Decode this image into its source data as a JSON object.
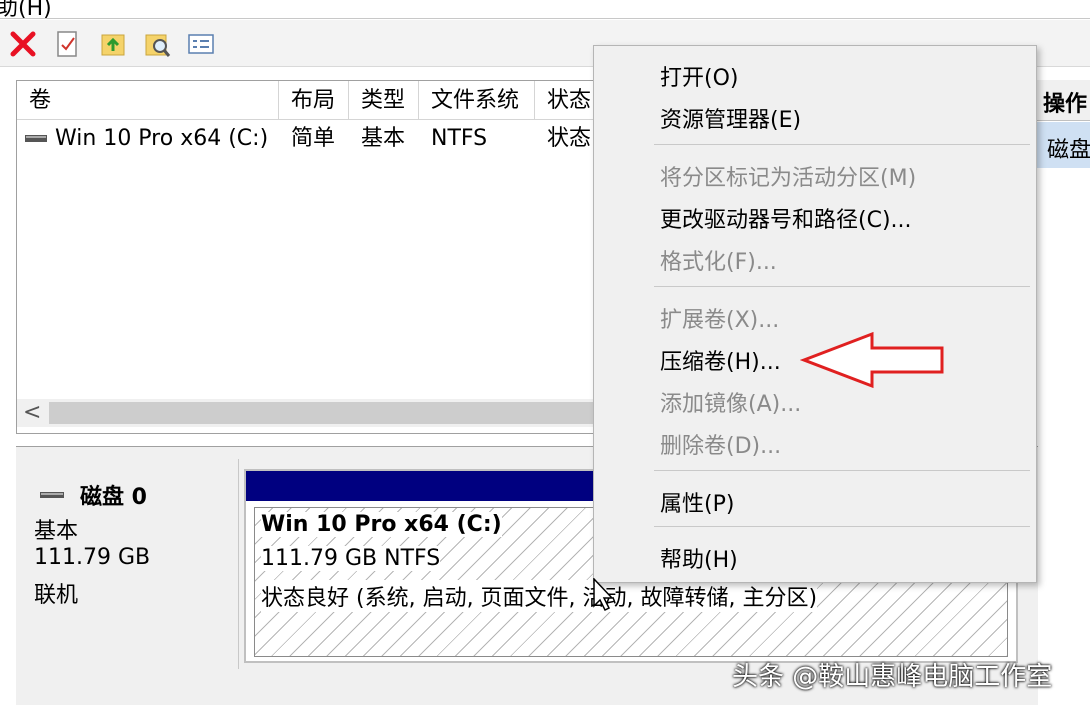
{
  "menubar": {
    "partial": "助(H)"
  },
  "volume_table": {
    "columns": [
      "卷",
      "布局",
      "类型",
      "文件系统",
      "状态"
    ],
    "rows": [
      {
        "volume": "Win 10 Pro x64 (C:)",
        "layout": "简单",
        "type": "基本",
        "fs": "NTFS",
        "status": "状态"
      }
    ],
    "scroll_arrow": "<"
  },
  "actions": {
    "title": "操作",
    "item": "磁盘"
  },
  "disk": {
    "name": "磁盘 0",
    "kind": "基本",
    "size": "111.79 GB",
    "state": "联机",
    "partition": {
      "title": "Win 10 Pro x64  (C:)",
      "size_fs": "111.79 GB NTFS",
      "status": "状态良好 (系统, 启动, 页面文件, 活动, 故障转储, 主分区)"
    }
  },
  "context_menu": {
    "items": [
      {
        "label": "打开(O)",
        "enabled": true
      },
      {
        "label": "资源管理器(E)",
        "enabled": true
      },
      {
        "label": "将分区标记为活动分区(M)",
        "enabled": false
      },
      {
        "label": "更改驱动器号和路径(C)...",
        "enabled": true
      },
      {
        "label": "格式化(F)...",
        "enabled": false
      },
      {
        "label": "扩展卷(X)...",
        "enabled": false
      },
      {
        "label": "压缩卷(H)...",
        "enabled": true
      },
      {
        "label": "添加镜像(A)...",
        "enabled": false
      },
      {
        "label": "删除卷(D)...",
        "enabled": false
      },
      {
        "label": "属性(P)",
        "enabled": true
      },
      {
        "label": "帮助(H)",
        "enabled": true
      }
    ]
  },
  "watermark": "头条 @鞍山惠峰电脑工作室",
  "colors": {
    "accent_arrow": "#e02020",
    "partition_bar": "#000080",
    "delete_icon": "#e81123"
  }
}
